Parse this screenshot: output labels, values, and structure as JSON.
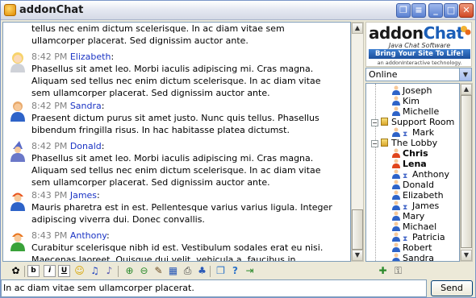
{
  "window": {
    "title": "addonChat"
  },
  "messages": [
    {
      "time": "",
      "nick": "",
      "avatar": "lead-user-icon",
      "text": "tellus nec enim dictum scelerisque. In ac diam vitae sem ullamcorper placerat. Sed dignissim auctor ante."
    },
    {
      "time": "8:42 PM",
      "nick": "Elizabeth",
      "avatar": "blonde-user-icon",
      "text": "Phasellus sit amet leo. Morbi iaculis adipiscing mi. Cras magna. Aliquam sed tellus nec enim dictum scelerisque. In ac diam vitae sem ullamcorper placerat. Sed dignissim auctor ante."
    },
    {
      "time": "8:42 PM",
      "nick": "Sandra",
      "avatar": "user-icon",
      "text": "Praesent dictum purus sit amet justo. Nunc quis tellus. Phasellus bibendum fringilla risus. In hac habitasse platea dictumst."
    },
    {
      "time": "8:42 PM",
      "nick": "Donald",
      "avatar": "wizard-user-icon",
      "text": "Phasellus sit amet leo. Morbi iaculis adipiscing mi. Cras magna. Aliquam sed tellus nec enim dictum scelerisque. In ac diam vitae sem ullamcorper placerat. Sed dignissim auctor ante."
    },
    {
      "time": "8:43 PM",
      "nick": "James",
      "avatar": "hardhat-user-icon",
      "text": "Mauris pharetra est in est. Pellentesque varius varius ligula. Integer adipiscing viverra dui. Donec convallis."
    },
    {
      "time": "8:43 PM",
      "nick": "Anthony",
      "avatar": "hardhat-green-user-icon",
      "text": "Curabitur scelerisque nibh id est. Vestibulum sodales erat eu nisi. Maecenas laoreet. Quisque dui velit, vehicula a, faucibus in,"
    }
  ],
  "input": {
    "value": "In ac diam vitae sem ullamcorper placerat."
  },
  "send_button": "Send",
  "logo": {
    "brand_a": "addon",
    "brand_b": "Chat",
    "tagline": "Java Chat Software",
    "banner": "Bring Your Site To Life!",
    "footer": "an addonInteractive technology."
  },
  "status": {
    "selected": "Online"
  },
  "tree": [
    {
      "label": "Joseph",
      "kind": "user",
      "bold": false,
      "indent": 2
    },
    {
      "label": "Kim",
      "kind": "user",
      "bold": false,
      "indent": 2
    },
    {
      "label": "Michelle",
      "kind": "user",
      "bold": false,
      "indent": 2
    },
    {
      "label": "Support Room",
      "kind": "room",
      "bold": false,
      "indent": 0
    },
    {
      "label": "Mark",
      "kind": "user-away",
      "bold": false,
      "indent": 2
    },
    {
      "label": "The Lobby",
      "kind": "room",
      "bold": false,
      "indent": 0
    },
    {
      "label": "Chris",
      "kind": "admin",
      "bold": true,
      "indent": 2
    },
    {
      "label": "Lena",
      "kind": "admin",
      "bold": true,
      "indent": 2
    },
    {
      "label": "Anthony",
      "kind": "user-away",
      "bold": false,
      "indent": 2
    },
    {
      "label": "Donald",
      "kind": "user",
      "bold": false,
      "indent": 2
    },
    {
      "label": "Elizabeth",
      "kind": "user",
      "bold": false,
      "indent": 2
    },
    {
      "label": "James",
      "kind": "user-away",
      "bold": false,
      "indent": 2
    },
    {
      "label": "Mary",
      "kind": "user",
      "bold": false,
      "indent": 2
    },
    {
      "label": "Michael",
      "kind": "user",
      "bold": false,
      "indent": 2
    },
    {
      "label": "Patricia",
      "kind": "user-away",
      "bold": false,
      "indent": 2
    },
    {
      "label": "Robert",
      "kind": "user",
      "bold": false,
      "indent": 2
    },
    {
      "label": "Sandra",
      "kind": "user",
      "bold": false,
      "indent": 2
    }
  ],
  "format_tools": [
    {
      "name": "color-palette-icon",
      "glyph": "✿"
    },
    {
      "name": "bold-button",
      "glyph": "b"
    },
    {
      "name": "italic-button",
      "glyph": "i"
    },
    {
      "name": "underline-button",
      "glyph": "U"
    },
    {
      "name": "smiley-icon",
      "glyph": "☺"
    },
    {
      "name": "music-note-icon",
      "glyph": "♫"
    },
    {
      "name": "sound-icon",
      "glyph": "♪"
    },
    {
      "name": "zoom-in-icon",
      "glyph": "⊕"
    },
    {
      "name": "zoom-out-icon",
      "glyph": "⊖"
    },
    {
      "name": "clear-icon",
      "glyph": "✎"
    },
    {
      "name": "calendar-icon",
      "glyph": "▦"
    },
    {
      "name": "print-icon",
      "glyph": "⎙"
    },
    {
      "name": "bell-icon",
      "glyph": "♣"
    },
    {
      "name": "windows-icon",
      "glyph": "❐"
    },
    {
      "name": "help-icon",
      "glyph": "?"
    },
    {
      "name": "exit-icon",
      "glyph": "⇥"
    }
  ],
  "side_tools": [
    {
      "name": "add-user-icon",
      "glyph": "✚"
    },
    {
      "name": "lock-icon",
      "glyph": "⚿"
    }
  ]
}
